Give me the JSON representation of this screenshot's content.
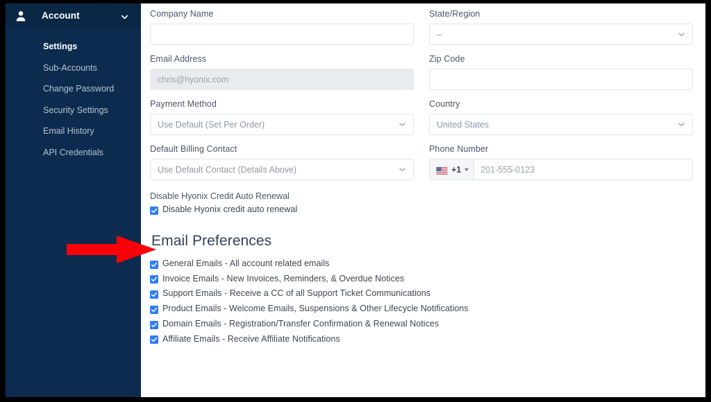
{
  "sidebar": {
    "header": {
      "label": "Account",
      "user_icon": "user-icon",
      "chevron_icon": "chevron-down-icon"
    },
    "items": [
      {
        "label": "Settings",
        "active": true
      },
      {
        "label": "Sub-Accounts",
        "active": false
      },
      {
        "label": "Change Password",
        "active": false
      },
      {
        "label": "Security Settings",
        "active": false
      },
      {
        "label": "Email History",
        "active": false
      },
      {
        "label": "API Credentials",
        "active": false
      }
    ],
    "bg_color": "#0d2b4e"
  },
  "form": {
    "left": {
      "company_name": {
        "label": "Company Name",
        "value": "",
        "placeholder": ""
      },
      "email_address": {
        "label": "Email Address",
        "value": "chris@hyonix.com",
        "readonly": true
      },
      "payment_method": {
        "label": "Payment Method",
        "selected": "Use Default (Set Per Order)"
      },
      "default_billing_contact": {
        "label": "Default Billing Contact",
        "selected": "Use Default Contact (Details Above)"
      }
    },
    "right": {
      "state_region": {
        "label": "State/Region",
        "selected": "–"
      },
      "zip_code": {
        "label": "Zip Code",
        "value": "",
        "placeholder": ""
      },
      "country": {
        "label": "Country",
        "selected": "United States"
      },
      "phone_number": {
        "label": "Phone Number",
        "dial_code": "+1",
        "flag": "us-flag-icon",
        "value": "",
        "placeholder": "201-555-0123"
      }
    }
  },
  "auto_renewal": {
    "section_label": "Disable Hyonix Credit Auto Renewal",
    "checkbox_label": "Disable Hyonix credit auto renewal",
    "checked": true
  },
  "email_preferences": {
    "title": "Email Preferences",
    "items": [
      {
        "label": "General Emails - All account related emails",
        "checked": true
      },
      {
        "label": "Invoice Emails - New Invoices, Reminders, & Overdue Notices",
        "checked": true
      },
      {
        "label": "Support Emails - Receive a CC of all Support Ticket Communications",
        "checked": true
      },
      {
        "label": "Product Emails - Welcome Emails, Suspensions & Other Lifecycle Notifications",
        "checked": true
      },
      {
        "label": "Domain Emails - Registration/Transfer Confirmation & Renewal Notices",
        "checked": true
      },
      {
        "label": "Affiliate Emails - Receive Affiliate Notifications",
        "checked": true
      }
    ]
  },
  "annotation": {
    "arrow": "red-arrow-pointer",
    "color": "#fb0007",
    "points_to": "Disable Hyonix credit auto renewal checkbox"
  },
  "colors": {
    "sidebar": "#0d2b4e",
    "sidebar_header": "#0b2746",
    "checkbox_blue": "#2d7df6",
    "label_text": "#4a5568",
    "heading": "#34405a",
    "frame": "#000000"
  }
}
